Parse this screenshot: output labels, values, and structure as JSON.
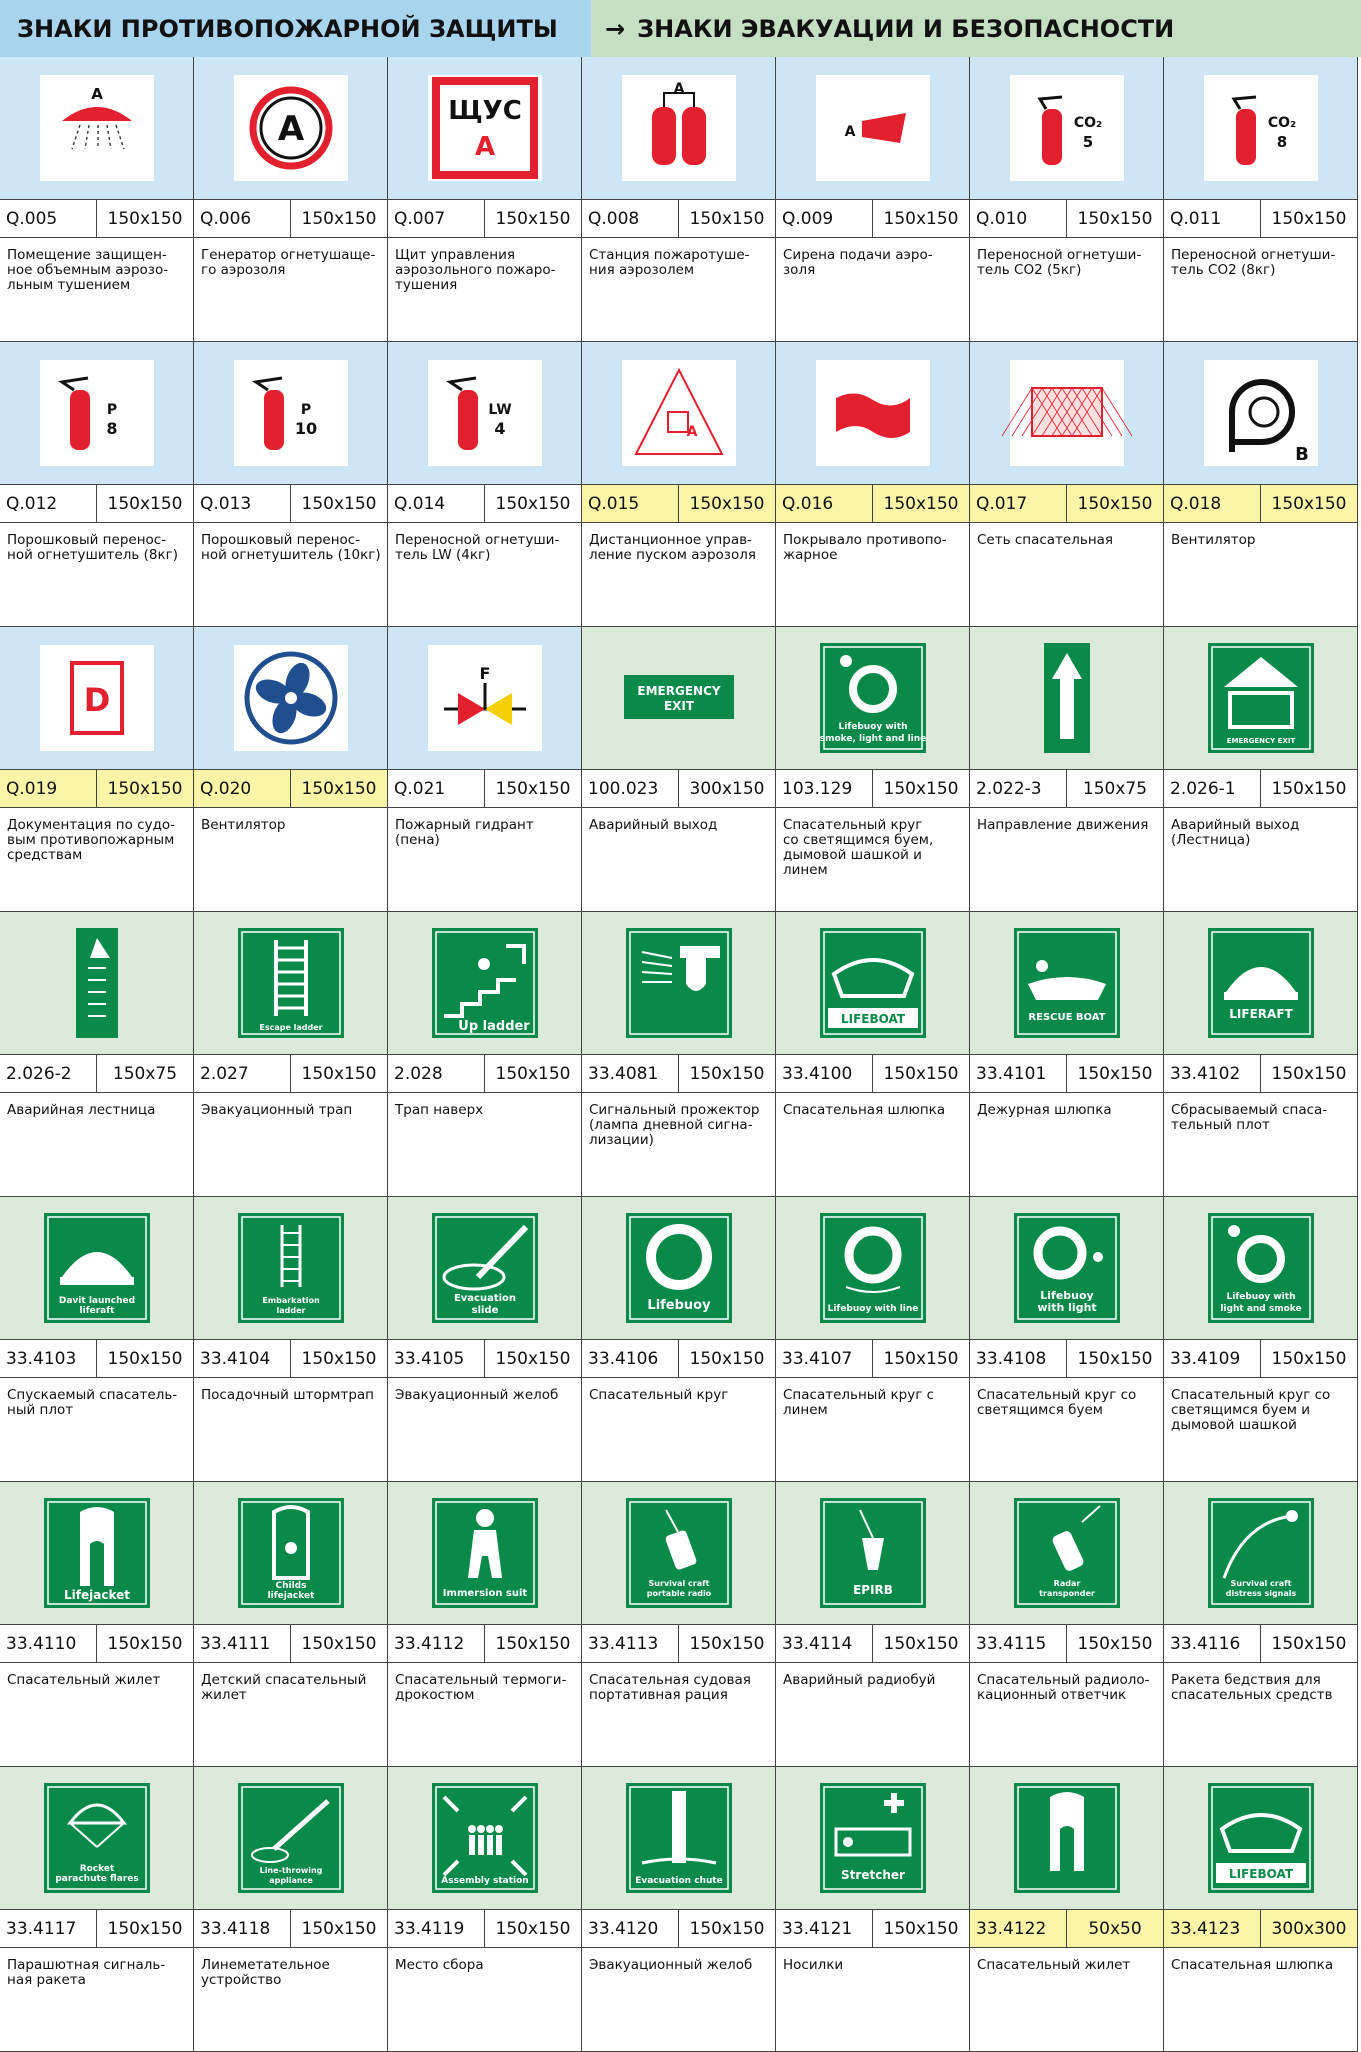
{
  "header": {
    "left_title": "ЗНАКИ ПРОТИВОПОЖАРНОЙ ЗАЩИТЫ",
    "right_arrow": "→",
    "right_title": "ЗНАКИ ЭВАКУАЦИИ И БЕЗОПАСНОСТИ"
  },
  "colors": {
    "header_blue": "#a9d4ee",
    "header_green": "#c4dfc2",
    "sign_red": "#e3202e",
    "sign_green": "#0a8a48",
    "highlight_yellow": "#fbf5a8"
  },
  "cells": [
    {
      "code": "Q.005",
      "size": "150x150",
      "desc": "Помещение защищен-\nное объемным аэрозо-\nльным тушением",
      "icon": "aerosol-room-icon",
      "sign_text": "A",
      "hl": false,
      "bg": "blue"
    },
    {
      "code": "Q.006",
      "size": "150x150",
      "desc": "Генератор огнетушаще-\nго аэрозоля",
      "icon": "aerosol-generator-icon",
      "sign_text": "A",
      "hl": false,
      "bg": "blue"
    },
    {
      "code": "Q.007",
      "size": "150x150",
      "desc": "Щит управления\nаэрозольного пожаро-\nтушения",
      "icon": "control-panel-icon",
      "sign_text": "ЩУС",
      "sign_text2": "A",
      "hl": false,
      "bg": "blue"
    },
    {
      "code": "Q.008",
      "size": "150x150",
      "desc": "Станция пожаротуше-\nния аэрозолем",
      "icon": "aerosol-station-icon",
      "sign_text": "A",
      "hl": false,
      "bg": "blue"
    },
    {
      "code": "Q.009",
      "size": "150x150",
      "desc": "Сирена подачи аэро-\nзоля",
      "icon": "siren-icon",
      "sign_text": "A",
      "hl": false,
      "bg": "blue"
    },
    {
      "code": "Q.010",
      "size": "150x150",
      "desc": "Переносной огнетуши-\nтель CO2 (5кг)",
      "icon": "co2-extinguisher-5-icon",
      "sign_text": "CO₂",
      "sign_text2": "5",
      "hl": false,
      "bg": "blue"
    },
    {
      "code": "Q.011",
      "size": "150x150",
      "desc": "Переносной огнетуши-\nтель CO2 (8кг)",
      "icon": "co2-extinguisher-8-icon",
      "sign_text": "CO₂",
      "sign_text2": "8",
      "hl": false,
      "bg": "blue"
    },
    {
      "code": "Q.012",
      "size": "150x150",
      "desc": "Порошковый перенос-\nной огнетушитель (8кг)",
      "icon": "powder-extinguisher-8-icon",
      "sign_text": "P",
      "sign_text2": "8",
      "hl": false,
      "bg": "blue"
    },
    {
      "code": "Q.013",
      "size": "150x150",
      "desc": "Порошковый перенос-\nной огнетушитель (10кг)",
      "icon": "powder-extinguisher-10-icon",
      "sign_text": "P",
      "sign_text2": "10",
      "hl": false,
      "bg": "blue"
    },
    {
      "code": "Q.014",
      "size": "150x150",
      "desc": "Переносной огнетуши-\nтель LW (4кг)",
      "icon": "lw-extinguisher-icon",
      "sign_text": "LW",
      "sign_text2": "4",
      "hl": false,
      "bg": "blue"
    },
    {
      "code": "Q.015",
      "size": "150x150",
      "desc": "Дистанционное управ-\nление пуском аэрозоля",
      "icon": "remote-release-icon",
      "sign_text": "A",
      "hl": true,
      "bg": "blue"
    },
    {
      "code": "Q.016",
      "size": "150x150",
      "desc": "Покрывало противопо-\nжарное",
      "icon": "fire-blanket-icon",
      "hl": true,
      "bg": "blue"
    },
    {
      "code": "Q.017",
      "size": "150x150",
      "desc": "Сеть спасательная",
      "icon": "rescue-net-icon",
      "hl": true,
      "bg": "blue"
    },
    {
      "code": "Q.018",
      "size": "150x150",
      "desc": "Вентилятор",
      "icon": "fan-duct-icon",
      "sign_text": "B",
      "hl": true,
      "bg": "blue"
    },
    {
      "code": "Q.019",
      "size": "150x150",
      "desc": "Документация по судо-\nвым противопожарным\nсредствам",
      "icon": "documentation-icon",
      "sign_text": "D",
      "hl": true,
      "bg": "blue"
    },
    {
      "code": "Q.020",
      "size": "150x150",
      "desc": "Вентилятор",
      "icon": "fan-icon",
      "hl": true,
      "bg": "blue"
    },
    {
      "code": "Q.021",
      "size": "150x150",
      "desc": "Пожарный гидрант\n(пена)",
      "icon": "hydrant-valve-icon",
      "sign_text": "F",
      "hl": false,
      "bg": "blue"
    },
    {
      "code": "100.023",
      "size": "300x150",
      "desc": "Аварийный выход",
      "icon": "emergency-exit-icon",
      "sign_text": "EMERGENCY",
      "sign_text2": "EXIT",
      "hl": false,
      "bg": "green"
    },
    {
      "code": "103.129",
      "size": "150x150",
      "desc": "Спасательный круг\nсо светящимся буем,\nдымовой шашкой и\nлинем",
      "icon": "lifebuoy-smoke-line-icon",
      "sign_text": "Lifebuoy with",
      "sign_text2": "smoke, light and line",
      "hl": false,
      "bg": "green"
    },
    {
      "code": "2.022-3",
      "size": "150x75",
      "desc": "Направление движения",
      "icon": "direction-arrow-icon",
      "hl": false,
      "bg": "green"
    },
    {
      "code": "2.026-1",
      "size": "150x150",
      "desc": "Аварийный выход\n(Лестница)",
      "icon": "emergency-exit-stairs-icon",
      "sign_text": "EMERGENCY EXIT",
      "hl": false,
      "bg": "green"
    },
    {
      "code": "2.026-2",
      "size": "150x75",
      "desc": "Аварийная лестница",
      "icon": "emergency-ladder-icon",
      "hl": false,
      "bg": "green"
    },
    {
      "code": "2.027",
      "size": "150x150",
      "desc": "Эвакуационный трап",
      "icon": "escape-ladder-icon",
      "sign_text": "Escape ladder",
      "hl": false,
      "bg": "green"
    },
    {
      "code": "2.028",
      "size": "150x150",
      "desc": "Трап наверх",
      "icon": "up-ladder-icon",
      "sign_text": "Up ladder",
      "hl": false,
      "bg": "green"
    },
    {
      "code": "33.4081",
      "size": "150x150",
      "desc": "Сигнальный прожектор\n(лампа дневной сигна-\nлизации)",
      "icon": "signal-lamp-icon",
      "hl": false,
      "bg": "green"
    },
    {
      "code": "33.4100",
      "size": "150x150",
      "desc": "Спасательная шлюпка",
      "icon": "lifeboat-icon",
      "sign_text": "LIFEBOAT",
      "hl": false,
      "bg": "green"
    },
    {
      "code": "33.4101",
      "size": "150x150",
      "desc": "Дежурная шлюпка",
      "icon": "rescue-boat-icon",
      "sign_text": "RESCUE BOAT",
      "hl": false,
      "bg": "green"
    },
    {
      "code": "33.4102",
      "size": "150x150",
      "desc": "Сбрасываемый спаса-\nтельный плот",
      "icon": "liferaft-icon",
      "sign_text": "LIFERAFT",
      "hl": false,
      "bg": "green"
    },
    {
      "code": "33.4103",
      "size": "150x150",
      "desc": "Спускаемый спасатель-\nный плот",
      "icon": "davit-liferaft-icon",
      "sign_text": "Davit launched",
      "sign_text2": "liferaft",
      "hl": false,
      "bg": "green"
    },
    {
      "code": "33.4104",
      "size": "150x150",
      "desc": "Посадочный штормтрап",
      "icon": "embarkation-ladder-icon",
      "sign_text": "Embarkation",
      "sign_text2": "ladder",
      "hl": false,
      "bg": "green"
    },
    {
      "code": "33.4105",
      "size": "150x150",
      "desc": "Эвакуационный желоб",
      "icon": "evacuation-slide-icon",
      "sign_text": "Evacuation",
      "sign_text2": "slide",
      "hl": false,
      "bg": "green"
    },
    {
      "code": "33.4106",
      "size": "150x150",
      "desc": "Спасательный круг",
      "icon": "lifebuoy-icon",
      "sign_text": "Lifebuoy",
      "hl": false,
      "bg": "green"
    },
    {
      "code": "33.4107",
      "size": "150x150",
      "desc": "Спасательный круг с\nлинем",
      "icon": "lifebuoy-line-icon",
      "sign_text": "Lifebuoy with line",
      "hl": false,
      "bg": "green"
    },
    {
      "code": "33.4108",
      "size": "150x150",
      "desc": "Спасательный круг со\nсветящимся буем",
      "icon": "lifebuoy-light-icon",
      "sign_text": "Lifebuoy",
      "sign_text2": "with light",
      "hl": false,
      "bg": "green"
    },
    {
      "code": "33.4109",
      "size": "150x150",
      "desc": "Спасательный круг со\nсветящимся буем и\nдымовой шашкой",
      "icon": "lifebuoy-light-smoke-icon",
      "sign_text": "Lifebuoy with",
      "sign_text2": "light and smoke",
      "hl": false,
      "bg": "green"
    },
    {
      "code": "33.4110",
      "size": "150x150",
      "desc": "Спасательный жилет",
      "icon": "lifejacket-icon",
      "sign_text": "Lifejacket",
      "hl": false,
      "bg": "green"
    },
    {
      "code": "33.4111",
      "size": "150x150",
      "desc": "Детский спасательный\nжилет",
      "icon": "childs-lifejacket-icon",
      "sign_text": "Childs",
      "sign_text2": "lifejacket",
      "hl": false,
      "bg": "green"
    },
    {
      "code": "33.4112",
      "size": "150x150",
      "desc": "Спасательный термоги-\nдрокостюм",
      "icon": "immersion-suit-icon",
      "sign_text": "Immersion suit",
      "hl": false,
      "bg": "green"
    },
    {
      "code": "33.4113",
      "size": "150x150",
      "desc": "Спасательная судовая\nпортативная рация",
      "icon": "portable-radio-icon",
      "sign_text": "Survival craft",
      "sign_text2": "portable radio",
      "hl": false,
      "bg": "green"
    },
    {
      "code": "33.4114",
      "size": "150x150",
      "desc": "Аварийный радиобуй",
      "icon": "epirb-icon",
      "sign_text": "EPIRB",
      "hl": false,
      "bg": "green"
    },
    {
      "code": "33.4115",
      "size": "150x150",
      "desc": "Спасательный радиоло-\nкационный ответчик",
      "icon": "radar-transponder-icon",
      "sign_text": "Radar",
      "sign_text2": "transponder",
      "hl": false,
      "bg": "green"
    },
    {
      "code": "33.4116",
      "size": "150x150",
      "desc": "Ракета бедствия для\nспасательных средств",
      "icon": "distress-signals-icon",
      "sign_text": "Survival craft",
      "sign_text2": "distress signals",
      "hl": false,
      "bg": "green"
    },
    {
      "code": "33.4117",
      "size": "150x150",
      "desc": "Парашютная сигналь-\nная ракета",
      "icon": "parachute-flare-icon",
      "sign_text": "Rocket",
      "sign_text2": "parachute flares",
      "hl": false,
      "bg": "green"
    },
    {
      "code": "33.4118",
      "size": "150x150",
      "desc": "Линеметательное\nустройство",
      "icon": "line-throwing-icon",
      "sign_text": "Line-throwing",
      "sign_text2": "appliance",
      "hl": false,
      "bg": "green"
    },
    {
      "code": "33.4119",
      "size": "150x150",
      "desc": "Место сбора",
      "icon": "assembly-station-icon",
      "sign_text": "Assembly station",
      "hl": false,
      "bg": "green"
    },
    {
      "code": "33.4120",
      "size": "150x150",
      "desc": "Эвакуационный желоб",
      "icon": "evacuation-chute-icon",
      "sign_text": "Evacuation chute",
      "hl": false,
      "bg": "green"
    },
    {
      "code": "33.4121",
      "size": "150x150",
      "desc": "Носилки",
      "icon": "stretcher-icon",
      "sign_text": "Stretcher",
      "hl": false,
      "bg": "green"
    },
    {
      "code": "33.4122",
      "size": "50x50",
      "desc": "Спасательный жилет",
      "icon": "small-lifejacket-icon",
      "hl": true,
      "bg": "green"
    },
    {
      "code": "33.4123",
      "size": "300x300",
      "desc": "Спасательная шлюпка",
      "icon": "lifeboat-large-icon",
      "sign_text": "LIFEBOAT",
      "hl": true,
      "bg": "green"
    }
  ]
}
